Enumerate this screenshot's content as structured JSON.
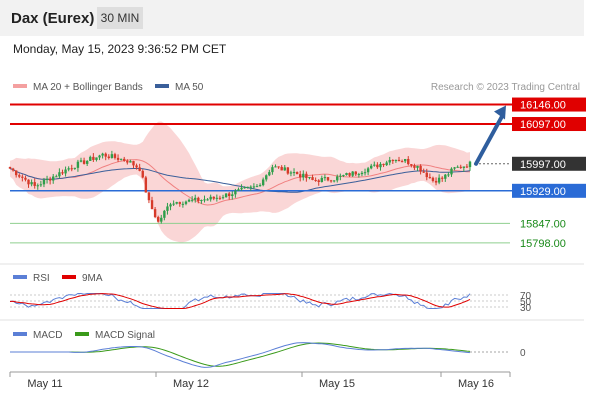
{
  "header": {
    "instrument": "Dax (Eurex)",
    "timeframe": "30 MIN"
  },
  "datetime": "Monday, May 15, 2023 9:36:52 PM CET",
  "chart_data": [
    {
      "type": "candlestick",
      "legend": [
        {
          "label": "MA 20 + Bollinger Bands",
          "color": "#f4a0a0"
        },
        {
          "label": "MA 50",
          "color": "#3a5f9a"
        }
      ],
      "credit": "Research © 2023 Trading Central",
      "y_range": [
        15760,
        16170
      ],
      "price_levels": [
        {
          "value": 16146,
          "label": "16146.00",
          "kind": "resistance",
          "color": "#e00000"
        },
        {
          "value": 16097,
          "label": "16097.00",
          "kind": "resistance",
          "color": "#e00000"
        },
        {
          "value": 15997,
          "label": "15997.00",
          "kind": "last",
          "color": "#333333"
        },
        {
          "value": 15929,
          "label": "15929.00",
          "kind": "pivot",
          "color": "#2a6bd6"
        },
        {
          "value": 15847,
          "label": "15847.00",
          "kind": "support",
          "color": "#1a8a1a"
        },
        {
          "value": 15798,
          "label": "15798.00",
          "kind": "support",
          "color": "#1a8a1a"
        }
      ],
      "x_ticks": [
        "May 11",
        "May 12",
        "May 15",
        "May 16"
      ],
      "forecast_arrow": {
        "from": 15997,
        "to": 16146
      }
    },
    {
      "type": "line",
      "legend": [
        {
          "label": "RSI",
          "color": "#5b7fd6"
        },
        {
          "label": "9MA",
          "color": "#e00000"
        }
      ],
      "levels": [
        "70",
        "50",
        "30"
      ]
    },
    {
      "type": "line",
      "legend": [
        {
          "label": "MACD",
          "color": "#5b7fd6"
        },
        {
          "label": "MACD Signal",
          "color": "#3a9a1a"
        }
      ],
      "levels": [
        "0"
      ]
    }
  ],
  "colors": {
    "up": "#2e9e4a",
    "down": "#d63a2a",
    "band": "#f8c8c8",
    "ma20": "#f08080",
    "ma50": "#3a5f9a"
  }
}
